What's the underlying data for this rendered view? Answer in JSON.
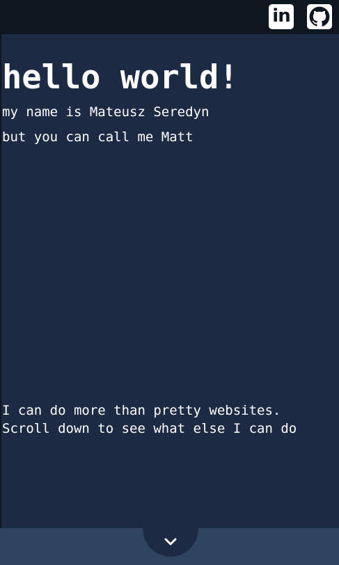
{
  "header": {
    "links": [
      {
        "name": "linkedin",
        "label": "in",
        "icon": "linkedin-icon"
      },
      {
        "name": "github",
        "icon": "github-icon"
      }
    ]
  },
  "hero": {
    "title": "hello world!",
    "intro_line_1": "my name is Mateusz Seredyn",
    "intro_line_2": "but you can call me Matt",
    "more_line_1": "I can do more than pretty websites.",
    "more_line_2": "Scroll down to see what else I can do"
  },
  "scroll_button": {
    "icon": "chevron-down-icon"
  },
  "colors": {
    "background": "#1c2a43",
    "topbar": "#0e161f",
    "bottombar": "#2e4560",
    "text": "#ffffff"
  }
}
